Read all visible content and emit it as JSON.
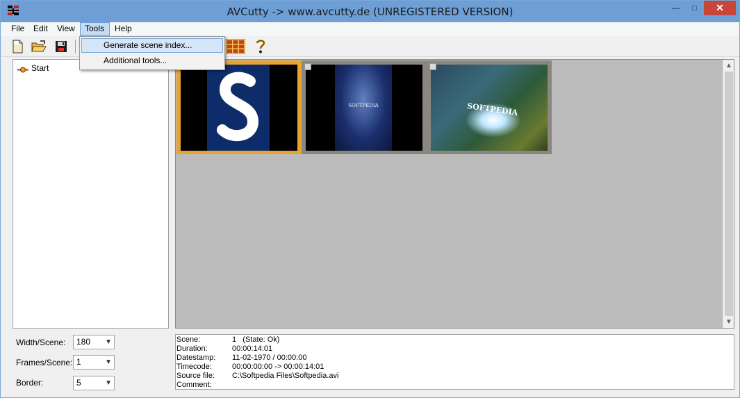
{
  "window": {
    "title": "AVCutty -> www.avcutty.de (UNREGISTERED VERSION)",
    "controls": {
      "minimize": "—",
      "maximize": "□",
      "close": "✕"
    }
  },
  "menu": {
    "file": "File",
    "edit": "Edit",
    "view": "View",
    "tools": "Tools",
    "help": "Help"
  },
  "tools_menu": {
    "items": [
      "Generate scene index...",
      "Additional tools..."
    ]
  },
  "toolbar": {
    "icons": [
      "new-file-icon",
      "open-folder-icon",
      "save-disk-icon",
      "scene-grid-icon",
      "help-question-icon"
    ]
  },
  "tree": {
    "root": "Start"
  },
  "thumbnails": {
    "count": 3,
    "selected_index": 0,
    "captions": [
      "SOFTPEDIA",
      "SOFTPEDIA"
    ]
  },
  "settings": {
    "width_label": "Width/Scene:",
    "width_value": "180",
    "frames_label": "Frames/Scene:",
    "frames_value": "1",
    "border_label": "Border:",
    "border_value": "5"
  },
  "info": {
    "rows": [
      {
        "key": "Scene:",
        "value": "1   (State: Ok)"
      },
      {
        "key": "Duration:",
        "value": "00:00:14:01"
      },
      {
        "key": "Datestamp:",
        "value": "11-02-1970 / 00:00:00"
      },
      {
        "key": "Timecode:",
        "value": "00:00:00:00 -> 00:00:14:01"
      },
      {
        "key": "Source file:",
        "value": "C:\\Softpedia Files\\Softpedia.avi"
      },
      {
        "key": "Comment:",
        "value": ""
      }
    ]
  },
  "colors": {
    "titlebar": "#6d9fd6",
    "close_button": "#c7463a",
    "selection_border": "#e8a430",
    "panel_bg": "#bcbcbc"
  }
}
